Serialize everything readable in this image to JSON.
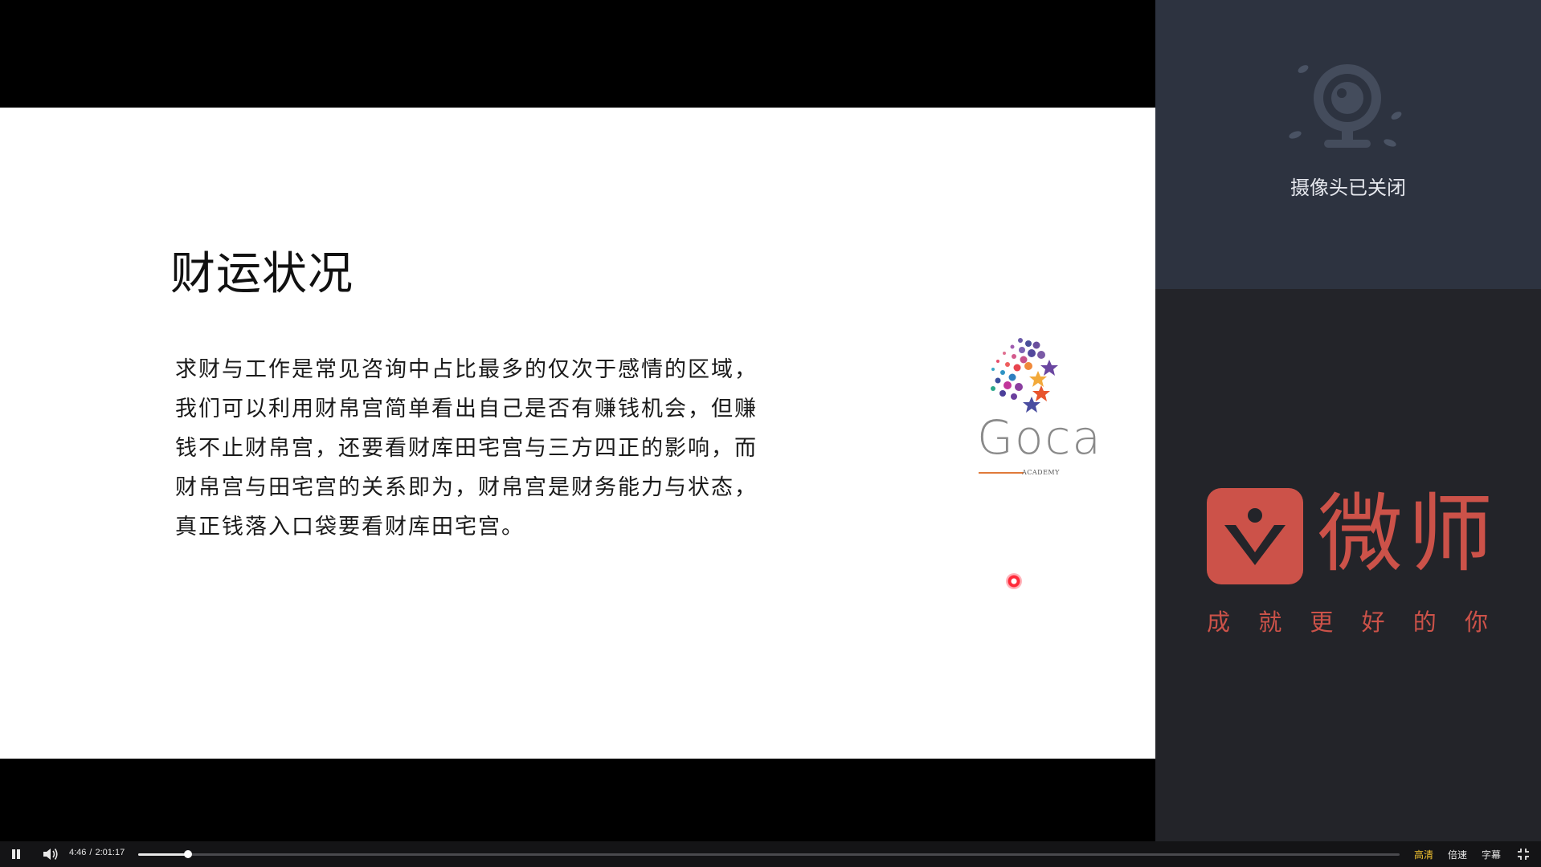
{
  "slide": {
    "title": "财运状况",
    "body_lines": [
      "求财与工作是常见咨询中占比最多的仅次于感情的区域，",
      "我们可以利用财帛宫简单看出自己是否有赚钱机会，但赚",
      "钱不止财帛宫，还要看财库田宅宫与三方四正的影响，而",
      "财帛宫与田宅宫的关系即为，财帛宫是财务能力与状态，",
      "真正钱落入口袋要看财库田宅宫。"
    ],
    "logo": {
      "name": "Goca",
      "subtitle": "ACADEMY"
    }
  },
  "camera": {
    "icon": "webcam-off-icon",
    "status": "摄像头已关闭"
  },
  "brand": {
    "name": "微师",
    "slogan": [
      "成",
      "就",
      "更",
      "好",
      "的",
      "你"
    ],
    "color": "#cc5249"
  },
  "player": {
    "current_time": "4:46",
    "total_time": "2:01:17",
    "progress": 0.0393,
    "quality_label": "高清",
    "speed_label": "倍速",
    "subtitle_label": "字幕",
    "accent": "#f2c230"
  }
}
